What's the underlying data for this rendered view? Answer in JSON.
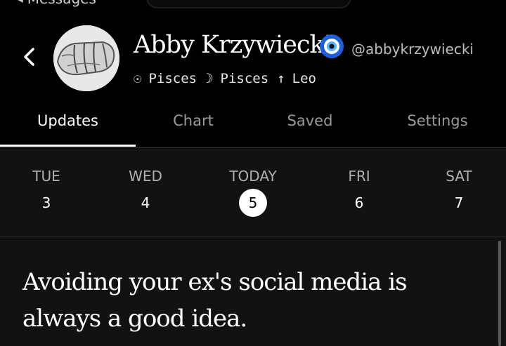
{
  "status": {
    "back_label": "Messages"
  },
  "profile": {
    "name": "Abby Krzywiecki",
    "handle": "@abbykrzywiecki",
    "sun_symbol": "☉",
    "sun_sign": "Pisces",
    "moon_symbol": "☽",
    "moon_sign": "Pisces",
    "rising_symbol": "↑",
    "rising_sign": "Leo"
  },
  "tabs": [
    {
      "label": "Updates",
      "active": true
    },
    {
      "label": "Chart",
      "active": false
    },
    {
      "label": "Saved",
      "active": false
    },
    {
      "label": "Settings",
      "active": false
    }
  ],
  "week": [
    {
      "label": "TUE",
      "num": "3"
    },
    {
      "label": "WED",
      "num": "4"
    },
    {
      "label": "TODAY",
      "num": "5",
      "today": true
    },
    {
      "label": "FRI",
      "num": "6"
    },
    {
      "label": "SAT",
      "num": "7"
    }
  ],
  "update": {
    "text": "Avoiding your ex's social media is always a good idea."
  },
  "colors": {
    "background": "#000000",
    "panel": "#121212",
    "accent": "#ffffff",
    "muted": "#9a9a9a"
  },
  "icons": {
    "back": "chevron-left-icon",
    "badge": "evil-eye-icon"
  }
}
